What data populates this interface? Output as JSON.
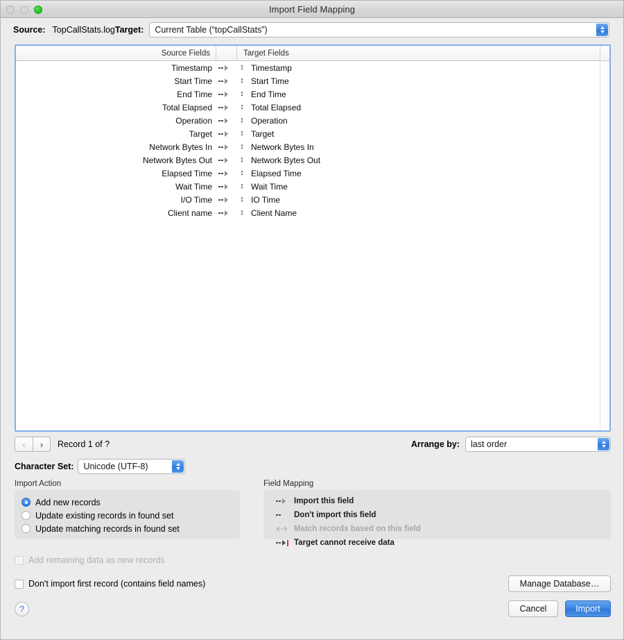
{
  "window": {
    "title": "Import Field Mapping",
    "traffic_lights": [
      "close",
      "minimize",
      "zoom"
    ]
  },
  "source_row": {
    "source_label": "Source:",
    "source_value": "TopCallStats.log",
    "target_label": "Target:",
    "target_value": "Current Table (“topCallStats”)"
  },
  "field_list": {
    "header_source": "Source Fields",
    "header_target": "Target Fields",
    "mapping_glyph": "import-this-field-icon",
    "order_glyph": "↕",
    "rows": [
      {
        "source": "Timestamp",
        "target": "Timestamp"
      },
      {
        "source": "Start Time",
        "target": "Start Time"
      },
      {
        "source": "End Time",
        "target": "End Time"
      },
      {
        "source": "Total Elapsed",
        "target": "Total Elapsed"
      },
      {
        "source": "Operation",
        "target": "Operation"
      },
      {
        "source": "Target",
        "target": "Target"
      },
      {
        "source": "Network Bytes In",
        "target": "Network Bytes In"
      },
      {
        "source": "Network Bytes Out",
        "target": "Network Bytes Out"
      },
      {
        "source": "Elapsed Time",
        "target": "Elapsed Time"
      },
      {
        "source": "Wait Time",
        "target": "Wait Time"
      },
      {
        "source": "I/O Time",
        "target": "IO Time"
      },
      {
        "source": "Client name",
        "target": "Client Name"
      }
    ]
  },
  "nav_row": {
    "prev_glyph": "‹",
    "next_glyph": "›",
    "record_label": "Record 1 of ?",
    "arrange_label": "Arrange by:",
    "arrange_value": "last order"
  },
  "charset_row": {
    "label": "Character Set:",
    "value": "Unicode (UTF-8)"
  },
  "import_action": {
    "title": "Import Action",
    "options": [
      {
        "label": "Add new records",
        "selected": true
      },
      {
        "label": "Update existing records in found set",
        "selected": false
      },
      {
        "label": "Update matching records in found set",
        "selected": false
      }
    ]
  },
  "field_mapping_legend": {
    "title": "Field Mapping",
    "items": [
      {
        "label": "Import this field",
        "icon": "import-this-field-icon",
        "enabled": true
      },
      {
        "label": "Don't import this field",
        "icon": "dont-import-field-icon",
        "enabled": true
      },
      {
        "label": "Match records based on this field",
        "icon": "match-records-icon",
        "enabled": false
      },
      {
        "label": "Target cannot receive data",
        "icon": "target-blocked-icon",
        "enabled": true
      }
    ]
  },
  "footer": {
    "add_remaining_label": "Add remaining data as new records",
    "add_remaining_checked": false,
    "add_remaining_enabled": false,
    "dont_import_first_label": "Don't import first record (contains field names)",
    "dont_import_first_checked": false,
    "help_glyph": "?",
    "manage_database_label": "Manage Database…",
    "cancel_label": "Cancel",
    "import_label": "Import"
  },
  "colors": {
    "accent_blue": "#2f7ada",
    "focus_ring": "#82aeec",
    "zoom_green": "#21c521",
    "blocked_red": "#d03a2f",
    "window_bg": "#ececec"
  }
}
